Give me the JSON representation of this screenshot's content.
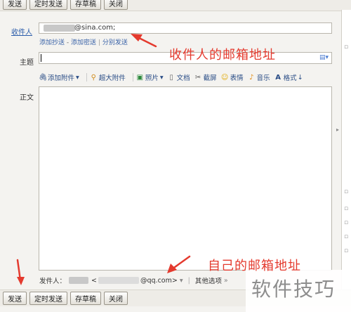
{
  "toolbar_top": {
    "send": "发送",
    "schedule": "定时发送",
    "draft": "存草稿",
    "close": "关闭"
  },
  "toolbar_bottom": {
    "send": "发送",
    "schedule": "定时发送",
    "draft": "存草稿",
    "close": "关闭"
  },
  "recipient": {
    "label": "收件人",
    "value": "@sina.com;"
  },
  "recipient_links": {
    "cc": "添加抄送",
    "dash": "-",
    "bcc": "添加密送",
    "sep": "|",
    "separate": "分别发送"
  },
  "subject": {
    "label": "主题",
    "value": ""
  },
  "format_bar": {
    "attach": "添加附件",
    "big_attach": "超大附件",
    "photo": "照片",
    "doc": "文档",
    "screenshot": "截屏",
    "emoji": "表情",
    "music": "音乐",
    "format": "格式"
  },
  "body": {
    "label": "正文"
  },
  "sender": {
    "label": "发件人：",
    "email_tail": "@qq.com>",
    "other": "其他选项"
  },
  "annotations": {
    "recipient_note": "收件人的邮箱地址",
    "sender_note": "自己的邮箱地址"
  },
  "watermark": "软件技巧",
  "icons": {
    "attach": "paperclip-icon",
    "big_attach": "link-icon",
    "photo": "image-icon",
    "doc": "document-icon",
    "screenshot": "scissors-icon",
    "emoji": "smiley-icon",
    "music": "music-note-icon",
    "format": "font-a-icon",
    "sort": "sort-icon"
  },
  "colors": {
    "annotation_red": "#e43a2e",
    "link_blue": "#2a5caa"
  }
}
